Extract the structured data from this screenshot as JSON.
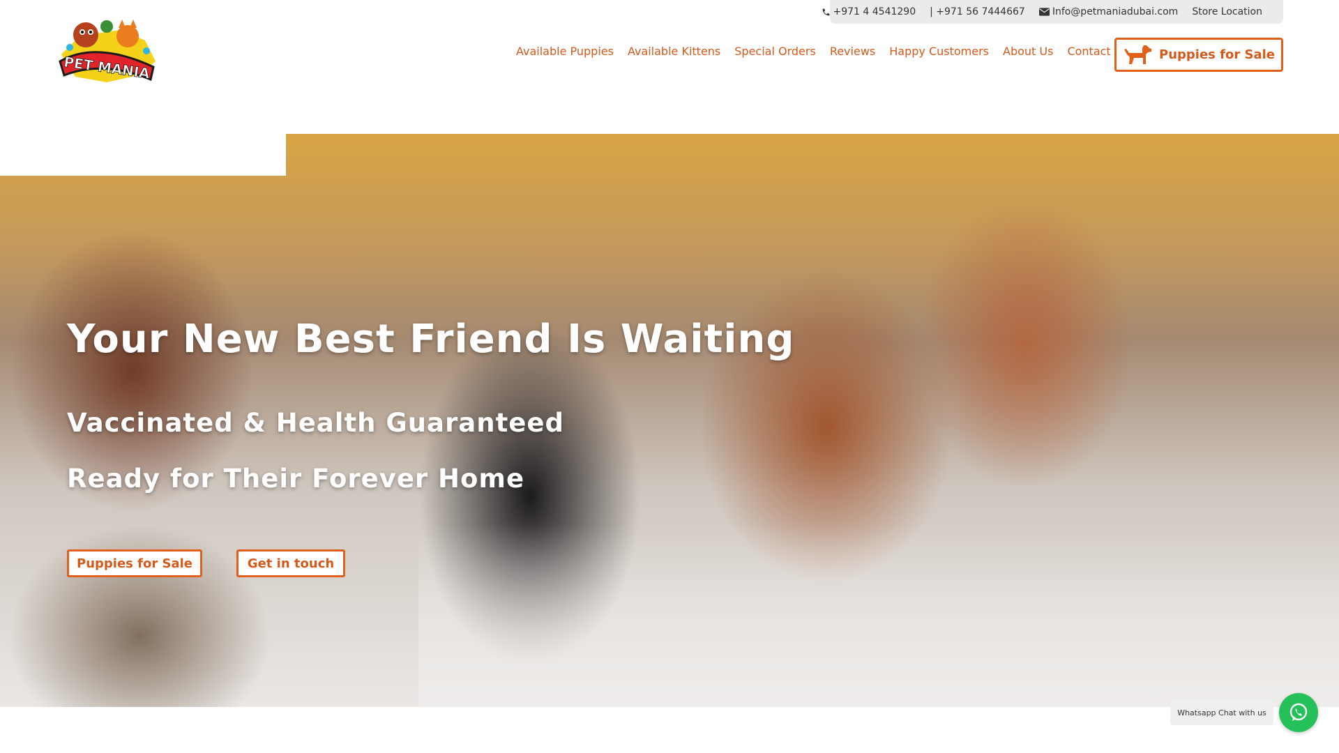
{
  "topbar": {
    "phone1": "+971 4 4541290",
    "phone2": "| +971 56 7444667",
    "email": "Info@petmaniadubai.com",
    "store": "Store Location"
  },
  "logo": {
    "text": "PET MANIA"
  },
  "nav": {
    "items": [
      {
        "label": "Available Puppies"
      },
      {
        "label": "Available Kittens"
      },
      {
        "label": "Special Orders"
      },
      {
        "label": "Reviews"
      },
      {
        "label": "Happy Customers"
      },
      {
        "label": "About Us"
      },
      {
        "label": "Contact us"
      }
    ],
    "cta_label": "Puppies for Sale"
  },
  "hero": {
    "title": "Your New Best Friend Is Waiting",
    "subtitle1": "Vaccinated & Health Guaranteed",
    "subtitle2": "Ready for Their Forever Home",
    "button1": "Puppies for Sale",
    "button2": "Get in touch"
  },
  "whatsapp": {
    "label": "Whatsapp Chat with us"
  },
  "colors": {
    "accent": "#e0601a",
    "nav_text": "#d35a1a",
    "whatsapp": "#25c05a"
  }
}
